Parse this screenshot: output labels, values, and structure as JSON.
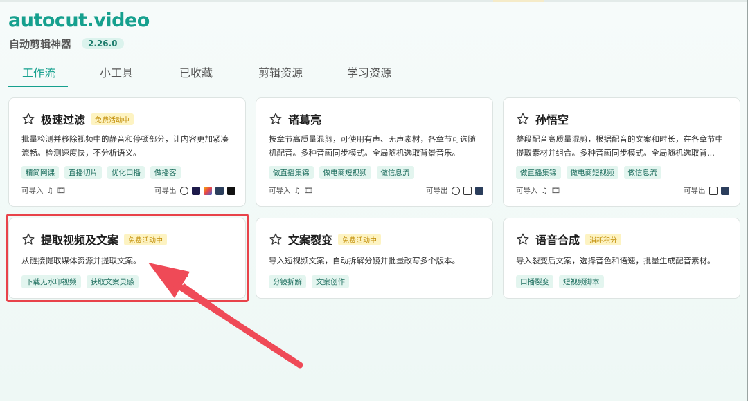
{
  "app": {
    "logo": "autocut.video",
    "subtitle": "自动剪辑神器",
    "version": "2.26.0"
  },
  "tabs": [
    {
      "label": "工作流",
      "active": true
    },
    {
      "label": "小工具"
    },
    {
      "label": "已收藏"
    },
    {
      "label": "剪辑资源"
    },
    {
      "label": "学习资源"
    }
  ],
  "io_labels": {
    "import": "可导入",
    "export": "可导出"
  },
  "cards": [
    {
      "title": "极速过滤",
      "badge": "免费活动中",
      "desc": "批量检测并移除视频中的静音和停顿部分，让内容更加紧凑流畅。检测速度快，不分析语义。",
      "tags": [
        "精简网课",
        "直播切片",
        "优化口播",
        "做播客"
      ]
    },
    {
      "title": "诸葛亮",
      "badge": "",
      "desc": "按章节高质量混剪，可使用有声、无声素材，各章节可选随机配音。多种音画同步模式。全局随机选取背景音乐。",
      "tags": [
        "做直播集锦",
        "做电商短视频",
        "做信息流"
      ]
    },
    {
      "title": "孙悟空",
      "badge": "",
      "desc": "整段配音高质量混剪，根据配音的文案和时长，在各章节中提取素材并组合。多种音画同步模式。全局随机选取背...",
      "tags": [
        "做直播集锦",
        "做电商短视频",
        "做信息流"
      ]
    },
    {
      "title": "提取视频及文案",
      "badge": "免费活动中",
      "desc": "从链接提取媒体资源并提取文案。",
      "tags": [
        "下载无水印视频",
        "获取文案灵感"
      ]
    },
    {
      "title": "文案裂变",
      "badge": "免费活动中",
      "desc": "导入短视频文案，自动拆解分镜并批量改写多个版本。",
      "tags": [
        "分镜拆解",
        "文案创作"
      ]
    },
    {
      "title": "语音合成",
      "badge": "消耗积分",
      "desc": "导入裂变后文案，选择音色和语速，批量生成配音素材。",
      "tags": [
        "口播裂变",
        "短视频脚本"
      ]
    }
  ],
  "colors": {
    "accent": "#16a08e",
    "highlight": "#e8434a",
    "badge_bg": "#fdf3c2"
  }
}
